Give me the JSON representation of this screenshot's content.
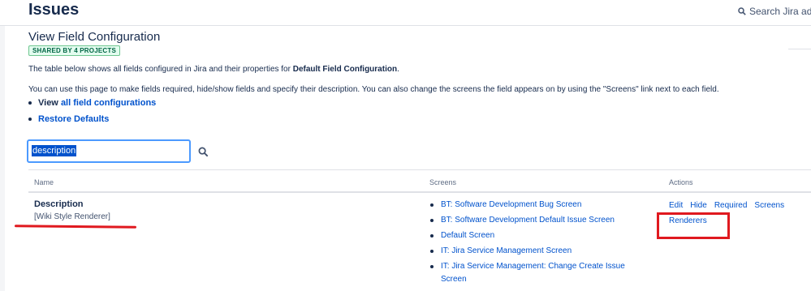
{
  "header": {
    "title": "Issues",
    "search_placeholder": "Search Jira adm"
  },
  "config": {
    "title": "View Field Configuration",
    "badge": "SHARED BY 4 PROJECTS",
    "intro_prefix": "The table below shows all fields configured in Jira and their properties for ",
    "intro_bold": "Default Field Configuration",
    "intro_suffix": ".",
    "help_text": "You can use this page to make fields required, hide/show fields and specify their description. You can also change the screens the field appears on by using the \"Screens\" link next to each field.",
    "links": [
      {
        "prefix": "View ",
        "label": "all field configurations"
      },
      {
        "prefix": "",
        "label": "Restore Defaults"
      }
    ]
  },
  "filter": {
    "value": "description"
  },
  "table": {
    "headers": {
      "name": "Name",
      "screens": "Screens",
      "actions": "Actions"
    },
    "row": {
      "name": "Description",
      "renderer": "[Wiki Style Renderer]",
      "screens": [
        "BT: Software Development Bug Screen",
        "BT: Software Development Default Issue Screen",
        "Default Screen",
        "IT: Jira Service Management Screen",
        "IT: Jira Service Management: Change Create Issue Screen"
      ],
      "actions": [
        "Edit",
        "Hide",
        "Required",
        "Screens"
      ],
      "renderers_action": "Renderers"
    }
  },
  "colors": {
    "link": "#0052cc",
    "annotation_red": "#e0191f",
    "badge_green": "#006644"
  }
}
